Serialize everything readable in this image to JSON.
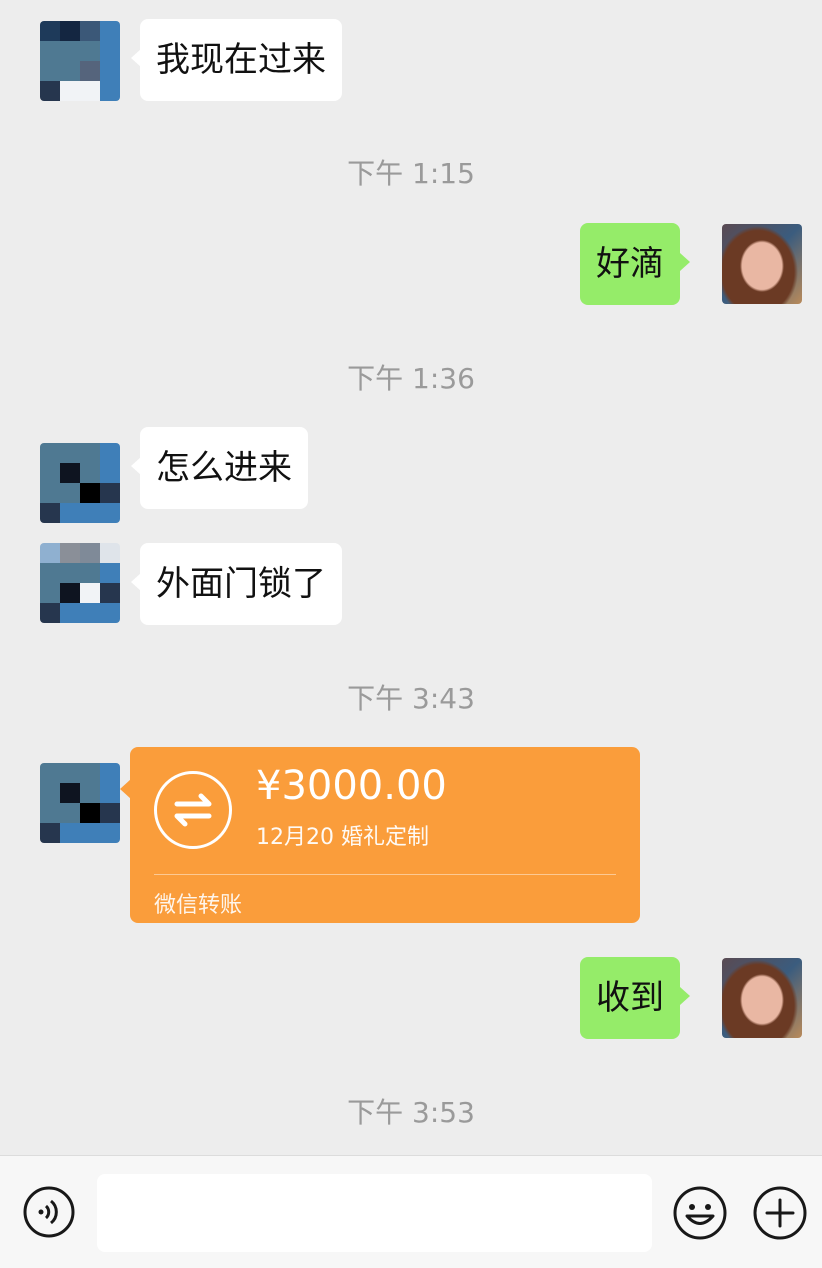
{
  "messages": {
    "m1": "我现在过来",
    "t1": "下午 1:15",
    "m2": "好滴",
    "t2": "下午 1:36",
    "m3": "怎么进来",
    "m4": "外面门锁了",
    "t3": "下午 3:43",
    "m5": "收到",
    "t4": "下午 3:53"
  },
  "transfer": {
    "amount": "¥3000.00",
    "memo": "12月20 婚礼定制",
    "kind": "微信转账"
  },
  "icons": {
    "voice": "voice-icon",
    "emoji": "emoji-icon",
    "plus": "plus-icon",
    "transfer": "transfer-icon"
  },
  "colors": {
    "background": "#ededed",
    "sent_bubble": "#95ec69",
    "received_bubble": "#ffffff",
    "transfer_card": "#fa9d3b",
    "timestamp": "#9a9a9a"
  }
}
